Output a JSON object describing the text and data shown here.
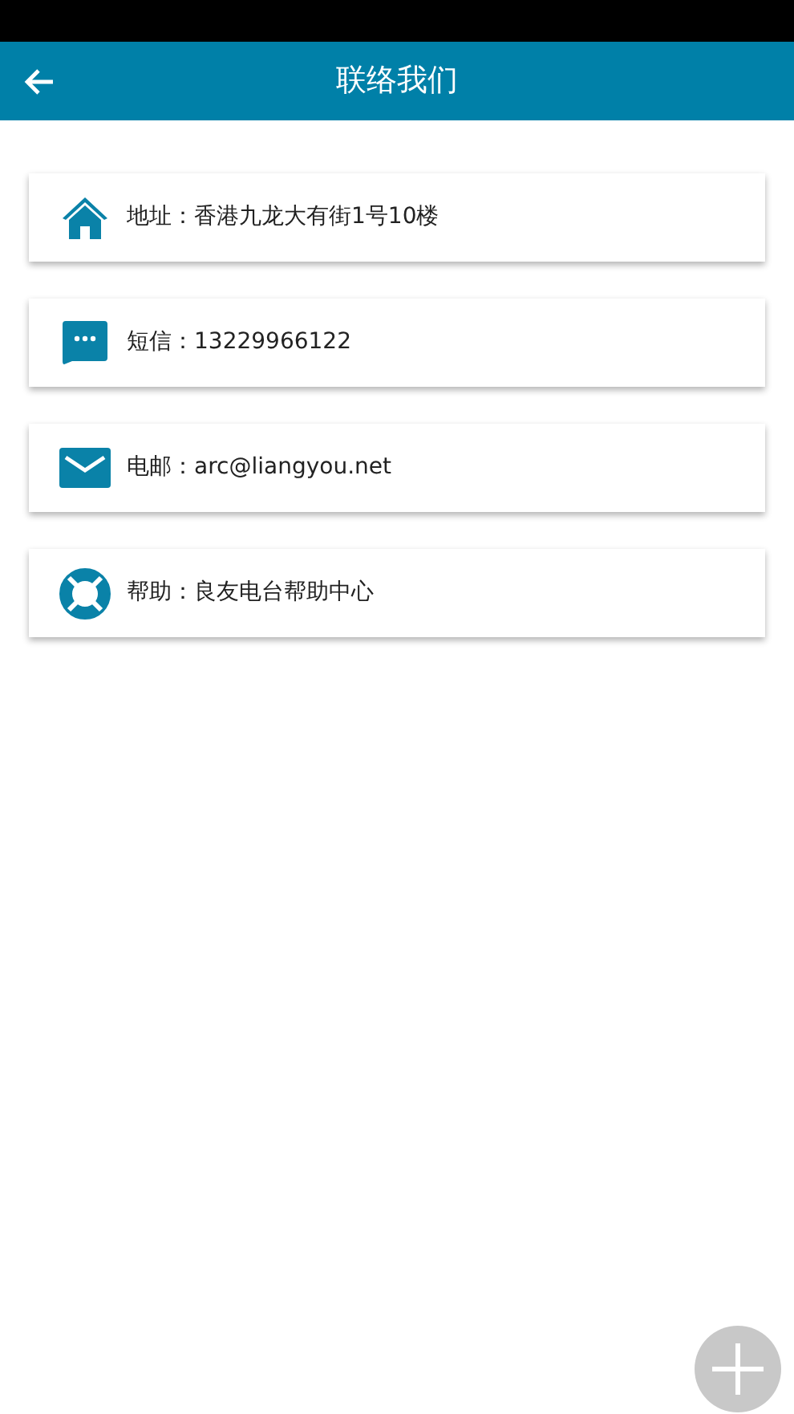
{
  "header": {
    "title": "联络我们"
  },
  "contacts": [
    {
      "kind": "home",
      "text": "地址：香港九龙大有街1号10楼"
    },
    {
      "kind": "message",
      "text": "短信：13229966122"
    },
    {
      "kind": "mail",
      "text": "电邮：arc@liangyou.net"
    },
    {
      "kind": "help",
      "text": "帮助：良友电台帮助中心"
    }
  ]
}
